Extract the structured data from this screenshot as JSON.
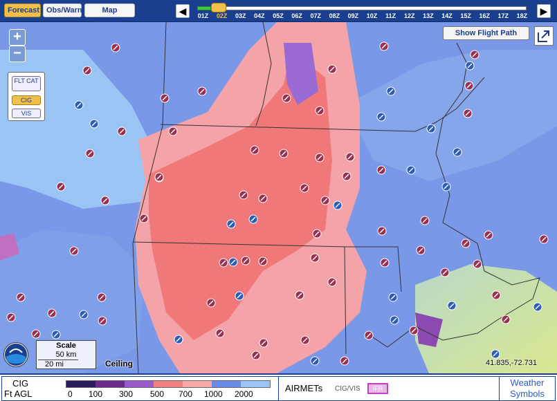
{
  "toolbar": {
    "forecast_label": "Forecast",
    "obswarn_label": "Obs/Warn",
    "mapoptions_label": "Map Options",
    "timeline_hours": [
      "01Z",
      "02Z",
      "03Z",
      "04Z",
      "05Z",
      "06Z",
      "07Z",
      "08Z",
      "09Z",
      "10Z",
      "11Z",
      "12Z",
      "13Z",
      "14Z",
      "15Z",
      "16Z",
      "17Z",
      "18Z"
    ],
    "selected_hour": "02Z"
  },
  "map": {
    "zoom_in_label": "+",
    "zoom_out_label": "−",
    "layers": {
      "fltcat_label": "FLT CAT",
      "cig_label": "CIG",
      "vis_label": "VIS",
      "selected": "CIG"
    },
    "show_flight_path_label": "Show Flight Path",
    "scale": {
      "title": "Scale",
      "km": "50 km",
      "mi": "20 mi"
    },
    "mode_label": "Ceiling",
    "coordinates": "41.835,-72.731"
  },
  "legend": {
    "cig_label": "CIG",
    "ftagl_label": "Ft AGL",
    "scale_colors": [
      "#2a1a5c",
      "#6a2a8c",
      "#9a5acc",
      "#f08080",
      "#f4a8a8",
      "#6a8ae8",
      "#9ac4f4"
    ],
    "ticks": [
      "0",
      "100",
      "300",
      "500",
      "700",
      "1000",
      "2000"
    ],
    "airmets_label": "AIRMETs",
    "cigvis_label": "CIG/VIS",
    "ifr_label": "IFR",
    "weather_symbols_label": "Weather Symbols"
  },
  "colors": {
    "blue_base": "#7a98e8",
    "pink": "#f4a4a8",
    "salmon": "#f07878",
    "light_blue": "#9ac4f4",
    "station_red": "#9a3050",
    "station_blue": "#2a5cb8"
  }
}
